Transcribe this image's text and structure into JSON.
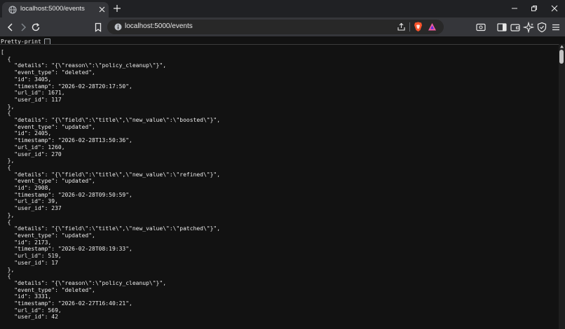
{
  "browser": {
    "tab": {
      "title": "localhost:5000/events"
    },
    "address": {
      "url": "localhost:5000/events"
    },
    "colors": {
      "brave_lion": "#fb542b",
      "rewards": "#f25c9e"
    }
  },
  "viewer": {
    "pretty_print_label": "Pretty-print",
    "pretty_print_checked": false
  },
  "json_text": "[\n  {\n    \"details\": \"{\\\"reason\\\":\\\"policy_cleanup\\\"}\",\n    \"event_type\": \"deleted\",\n    \"id\": 3405,\n    \"timestamp\": \"2026-02-28T20:17:50\",\n    \"url_id\": 1671,\n    \"user_id\": 117\n  },\n  {\n    \"details\": \"{\\\"field\\\":\\\"title\\\",\\\"new_value\\\":\\\"boosted\\\"}\",\n    \"event_type\": \"updated\",\n    \"id\": 2405,\n    \"timestamp\": \"2026-02-28T13:50:36\",\n    \"url_id\": 1260,\n    \"user_id\": 270\n  },\n  {\n    \"details\": \"{\\\"field\\\":\\\"title\\\",\\\"new_value\\\":\\\"refined\\\"}\",\n    \"event_type\": \"updated\",\n    \"id\": 2908,\n    \"timestamp\": \"2026-02-28T09:50:59\",\n    \"url_id\": 39,\n    \"user_id\": 237\n  },\n  {\n    \"details\": \"{\\\"field\\\":\\\"title\\\",\\\"new_value\\\":\\\"patched\\\"}\",\n    \"event_type\": \"updated\",\n    \"id\": 2173,\n    \"timestamp\": \"2026-02-28T08:19:33\",\n    \"url_id\": 519,\n    \"user_id\": 17\n  },\n  {\n    \"details\": \"{\\\"reason\\\":\\\"policy_cleanup\\\"}\",\n    \"event_type\": \"deleted\",\n    \"id\": 3331,\n    \"timestamp\": \"2026-02-27T16:40:21\",\n    \"url_id\": 569,\n    \"user_id\": 42"
}
